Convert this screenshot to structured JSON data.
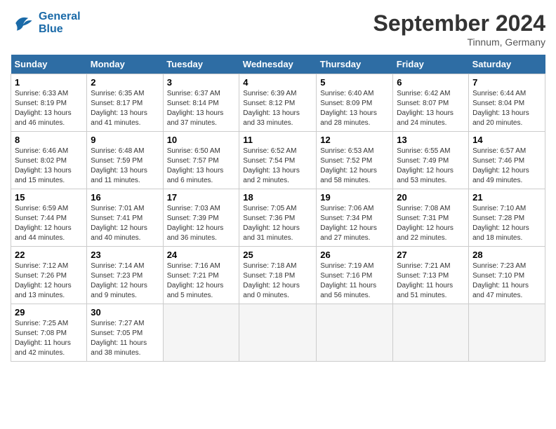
{
  "header": {
    "logo_line1": "General",
    "logo_line2": "Blue",
    "month": "September 2024",
    "location": "Tinnum, Germany"
  },
  "weekdays": [
    "Sunday",
    "Monday",
    "Tuesday",
    "Wednesday",
    "Thursday",
    "Friday",
    "Saturday"
  ],
  "weeks": [
    [
      {
        "day": "1",
        "sunrise": "6:33 AM",
        "sunset": "8:19 PM",
        "daylight": "13 hours and 46 minutes."
      },
      {
        "day": "2",
        "sunrise": "6:35 AM",
        "sunset": "8:17 PM",
        "daylight": "13 hours and 41 minutes."
      },
      {
        "day": "3",
        "sunrise": "6:37 AM",
        "sunset": "8:14 PM",
        "daylight": "13 hours and 37 minutes."
      },
      {
        "day": "4",
        "sunrise": "6:39 AM",
        "sunset": "8:12 PM",
        "daylight": "13 hours and 33 minutes."
      },
      {
        "day": "5",
        "sunrise": "6:40 AM",
        "sunset": "8:09 PM",
        "daylight": "13 hours and 28 minutes."
      },
      {
        "day": "6",
        "sunrise": "6:42 AM",
        "sunset": "8:07 PM",
        "daylight": "13 hours and 24 minutes."
      },
      {
        "day": "7",
        "sunrise": "6:44 AM",
        "sunset": "8:04 PM",
        "daylight": "13 hours and 20 minutes."
      }
    ],
    [
      {
        "day": "8",
        "sunrise": "6:46 AM",
        "sunset": "8:02 PM",
        "daylight": "13 hours and 15 minutes."
      },
      {
        "day": "9",
        "sunrise": "6:48 AM",
        "sunset": "7:59 PM",
        "daylight": "13 hours and 11 minutes."
      },
      {
        "day": "10",
        "sunrise": "6:50 AM",
        "sunset": "7:57 PM",
        "daylight": "13 hours and 6 minutes."
      },
      {
        "day": "11",
        "sunrise": "6:52 AM",
        "sunset": "7:54 PM",
        "daylight": "13 hours and 2 minutes."
      },
      {
        "day": "12",
        "sunrise": "6:53 AM",
        "sunset": "7:52 PM",
        "daylight": "12 hours and 58 minutes."
      },
      {
        "day": "13",
        "sunrise": "6:55 AM",
        "sunset": "7:49 PM",
        "daylight": "12 hours and 53 minutes."
      },
      {
        "day": "14",
        "sunrise": "6:57 AM",
        "sunset": "7:46 PM",
        "daylight": "12 hours and 49 minutes."
      }
    ],
    [
      {
        "day": "15",
        "sunrise": "6:59 AM",
        "sunset": "7:44 PM",
        "daylight": "12 hours and 44 minutes."
      },
      {
        "day": "16",
        "sunrise": "7:01 AM",
        "sunset": "7:41 PM",
        "daylight": "12 hours and 40 minutes."
      },
      {
        "day": "17",
        "sunrise": "7:03 AM",
        "sunset": "7:39 PM",
        "daylight": "12 hours and 36 minutes."
      },
      {
        "day": "18",
        "sunrise": "7:05 AM",
        "sunset": "7:36 PM",
        "daylight": "12 hours and 31 minutes."
      },
      {
        "day": "19",
        "sunrise": "7:06 AM",
        "sunset": "7:34 PM",
        "daylight": "12 hours and 27 minutes."
      },
      {
        "day": "20",
        "sunrise": "7:08 AM",
        "sunset": "7:31 PM",
        "daylight": "12 hours and 22 minutes."
      },
      {
        "day": "21",
        "sunrise": "7:10 AM",
        "sunset": "7:28 PM",
        "daylight": "12 hours and 18 minutes."
      }
    ],
    [
      {
        "day": "22",
        "sunrise": "7:12 AM",
        "sunset": "7:26 PM",
        "daylight": "12 hours and 13 minutes."
      },
      {
        "day": "23",
        "sunrise": "7:14 AM",
        "sunset": "7:23 PM",
        "daylight": "12 hours and 9 minutes."
      },
      {
        "day": "24",
        "sunrise": "7:16 AM",
        "sunset": "7:21 PM",
        "daylight": "12 hours and 5 minutes."
      },
      {
        "day": "25",
        "sunrise": "7:18 AM",
        "sunset": "7:18 PM",
        "daylight": "12 hours and 0 minutes."
      },
      {
        "day": "26",
        "sunrise": "7:19 AM",
        "sunset": "7:16 PM",
        "daylight": "11 hours and 56 minutes."
      },
      {
        "day": "27",
        "sunrise": "7:21 AM",
        "sunset": "7:13 PM",
        "daylight": "11 hours and 51 minutes."
      },
      {
        "day": "28",
        "sunrise": "7:23 AM",
        "sunset": "7:10 PM",
        "daylight": "11 hours and 47 minutes."
      }
    ],
    [
      {
        "day": "29",
        "sunrise": "7:25 AM",
        "sunset": "7:08 PM",
        "daylight": "11 hours and 42 minutes."
      },
      {
        "day": "30",
        "sunrise": "7:27 AM",
        "sunset": "7:05 PM",
        "daylight": "11 hours and 38 minutes."
      },
      null,
      null,
      null,
      null,
      null
    ]
  ]
}
